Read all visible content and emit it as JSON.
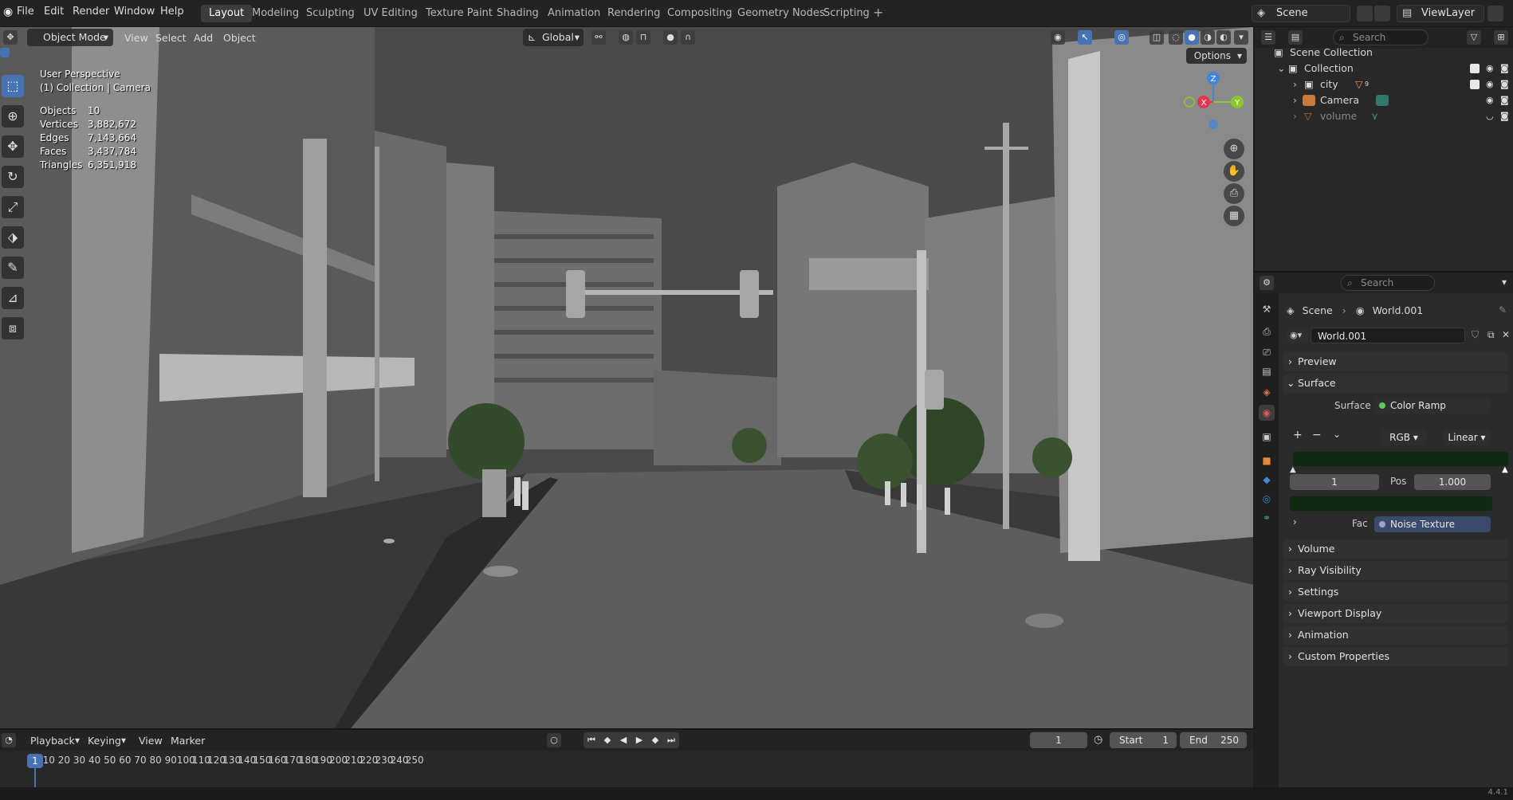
{
  "app": {
    "menu": [
      "File",
      "Edit",
      "Render",
      "Window",
      "Help"
    ],
    "workspaces": [
      "Layout",
      "Modeling",
      "Sculpting",
      "UV Editing",
      "Texture Paint",
      "Shading",
      "Animation",
      "Rendering",
      "Compositing",
      "Geometry Nodes",
      "Scripting"
    ],
    "active_workspace": "Layout",
    "scene": "Scene",
    "view_layer": "ViewLayer",
    "version": "4.4.1"
  },
  "viewport": {
    "mode": "Object Mode",
    "menus": [
      "View",
      "Select",
      "Add",
      "Object"
    ],
    "transform_orientation": "Global",
    "options_label": "Options",
    "view_name": "User Perspective",
    "collection_info": "(1) Collection | Camera",
    "stats": [
      {
        "label": "Objects",
        "value": "10"
      },
      {
        "label": "Vertices",
        "value": "3,882,672"
      },
      {
        "label": "Edges",
        "value": "7,143,664"
      },
      {
        "label": "Faces",
        "value": "3,437,784"
      },
      {
        "label": "Triangles",
        "value": "6,351,918"
      }
    ],
    "gizmo": {
      "x": "X",
      "y": "Y",
      "z": "Z"
    },
    "colors": {
      "x_axis": "#e2384f",
      "y_axis": "#8bc62c",
      "z_axis": "#3f86dc",
      "accent": "#4772b3"
    }
  },
  "outliner": {
    "search_placeholder": "Search",
    "items": [
      {
        "label": "Scene Collection",
        "icon": "scene-collection-icon"
      },
      {
        "label": "Collection",
        "icon": "collection-icon"
      },
      {
        "label": "city",
        "icon": "collection-icon",
        "badge": "9"
      },
      {
        "label": "Camera",
        "icon": "camera-icon"
      },
      {
        "label": "volume",
        "icon": "mesh-icon"
      }
    ]
  },
  "properties": {
    "search_placeholder": "Search",
    "breadcrumb": [
      "Scene",
      "World.001"
    ],
    "world_name": "World.001",
    "panels": {
      "preview": "Preview",
      "surface": "Surface",
      "volume": "Volume",
      "ray_visibility": "Ray Visibility",
      "settings": "Settings",
      "viewport_display": "Viewport Display",
      "animation": "Animation",
      "custom_properties": "Custom Properties"
    },
    "surface_label": "Surface",
    "surface_value": "Color Ramp",
    "ramp_color_mode": "RGB",
    "ramp_interpolation": "Linear",
    "ramp_index": "1",
    "pos_label": "Pos",
    "pos_value": "1.000",
    "fac_label": "Fac",
    "fac_value": "Noise Texture",
    "ramp_color": "#0f2a10"
  },
  "timeline": {
    "menus": [
      "Playback",
      "Keying",
      "View",
      "Marker"
    ],
    "current_frame": "1",
    "start_label": "Start",
    "start_value": "1",
    "end_label": "End",
    "end_value": "250",
    "ticks": [
      "1",
      "10",
      "20",
      "30",
      "40",
      "50",
      "60",
      "70",
      "80",
      "90",
      "100",
      "110",
      "120",
      "130",
      "140",
      "150",
      "160",
      "170",
      "180",
      "190",
      "200",
      "210",
      "220",
      "230",
      "240",
      "250"
    ]
  }
}
